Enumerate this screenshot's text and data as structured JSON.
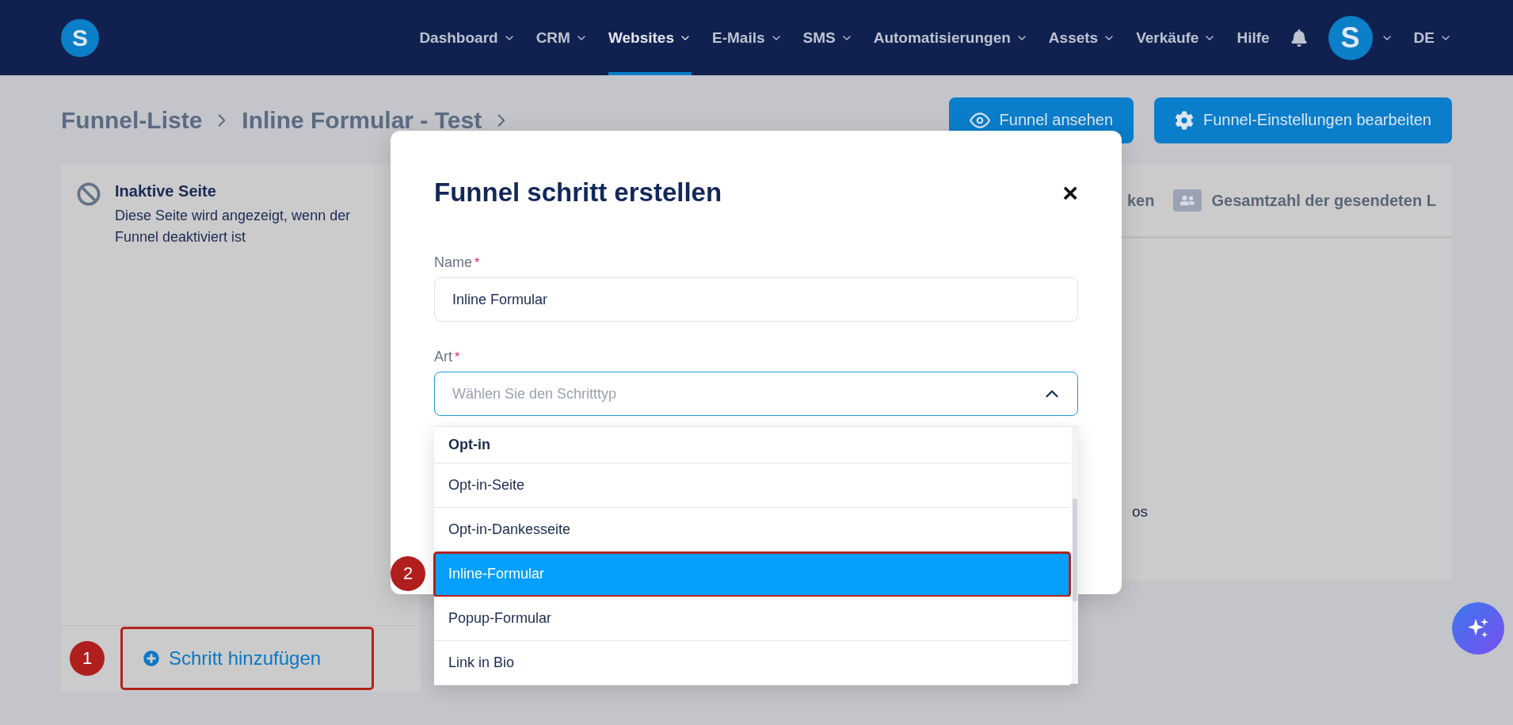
{
  "nav": {
    "logo": "S",
    "items": [
      {
        "label": "Dashboard",
        "selected": false,
        "has_menu": true
      },
      {
        "label": "CRM",
        "selected": false,
        "has_menu": true
      },
      {
        "label": "Websites",
        "selected": true,
        "has_menu": true
      },
      {
        "label": "E-Mails",
        "selected": false,
        "has_menu": true
      },
      {
        "label": "SMS",
        "selected": false,
        "has_menu": true
      },
      {
        "label": "Automatisierungen",
        "selected": false,
        "has_menu": true
      },
      {
        "label": "Assets",
        "selected": false,
        "has_menu": true
      },
      {
        "label": "Verkäufe",
        "selected": false,
        "has_menu": true
      },
      {
        "label": "Hilfe",
        "selected": false,
        "has_menu": false
      }
    ],
    "avatar": "S",
    "language": "DE"
  },
  "breadcrumb": [
    "Funnel-Liste",
    "Inline Formular - Test"
  ],
  "actions": [
    {
      "label": "Funnel ansehen"
    },
    {
      "label": "Funnel-Einstellungen bearbeiten"
    }
  ],
  "inactive_page": {
    "title": "Inaktive Seite",
    "description": "Diese Seite wird angezeigt, wenn der Funnel deaktiviert ist"
  },
  "add_step": {
    "label": "Schritt hinzufügen",
    "callout": "1",
    "highlighted": true
  },
  "stats": {
    "tabs": [
      {
        "label": "ken"
      },
      {
        "label": "Gesamtzahl der gesendeten L"
      }
    ],
    "row_text": "os"
  },
  "modal": {
    "title": "Funnel schritt erstellen",
    "close": "×",
    "name_field": {
      "label": "Name",
      "required_mark": "*",
      "value": "Inline Formular"
    },
    "type_field": {
      "label": "Art",
      "required_mark": "*",
      "placeholder": "Wählen Sie den Schritttyp",
      "expanded": true
    },
    "options": [
      {
        "kind": "group",
        "label": "Opt-in"
      },
      {
        "kind": "option",
        "label": "Opt-in-Seite",
        "selected": false,
        "highlighted": false
      },
      {
        "kind": "option",
        "label": "Opt-in-Dankesseite",
        "selected": false,
        "highlighted": false
      },
      {
        "kind": "option",
        "label": "Inline-Formular",
        "selected": true,
        "highlighted": true,
        "callout": "2"
      },
      {
        "kind": "option",
        "label": "Popup-Formular",
        "selected": false,
        "highlighted": false
      },
      {
        "kind": "option",
        "label": "Link in Bio",
        "selected": false,
        "highlighted": false
      }
    ]
  }
}
